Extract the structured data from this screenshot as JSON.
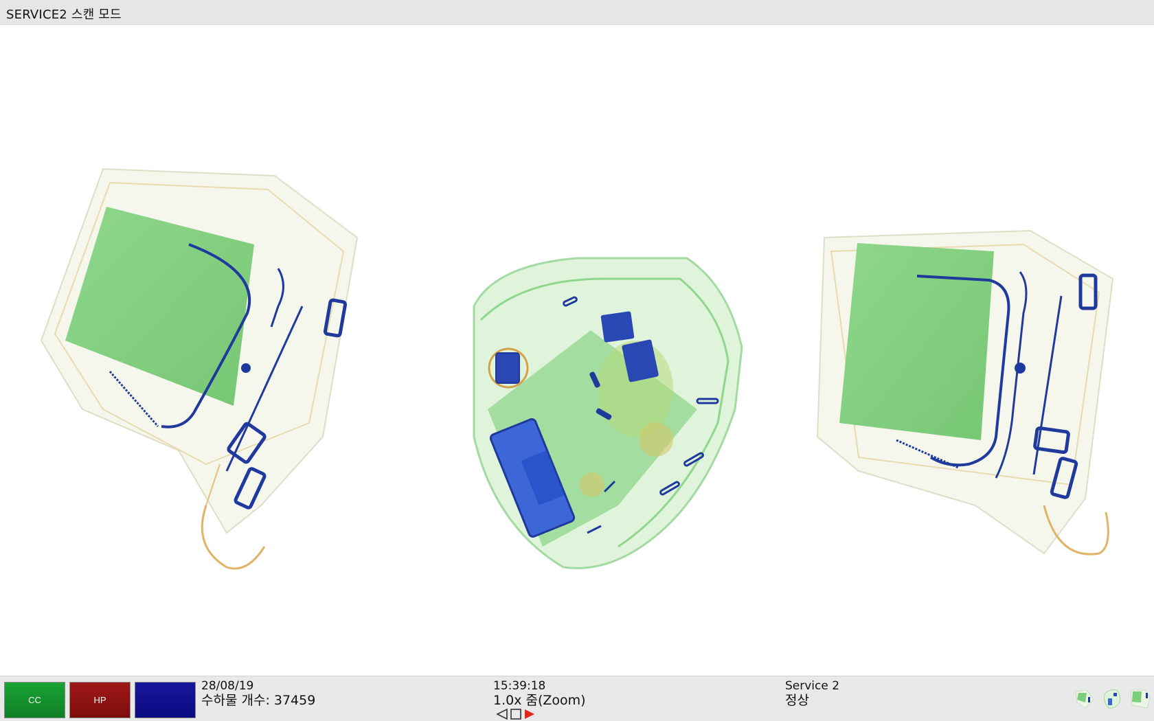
{
  "window": {
    "title": "SERVICE2 스캔 모드"
  },
  "buttons": [
    {
      "id": "cc",
      "label": "CC",
      "color": "#1aa334"
    },
    {
      "id": "hp",
      "label": "HP",
      "color": "#a01818"
    },
    {
      "id": "om",
      "label": "",
      "color": "#16169a"
    }
  ],
  "status": {
    "date": "28/08/19",
    "count_label": "수하물 개수: 37459",
    "time": "15:39:18",
    "zoom": "1.0x 줌(Zoom)",
    "service": "Service 2",
    "state": "정상"
  },
  "icons": {
    "prev": "prev-triangle-icon",
    "stop": "stop-square-icon",
    "play": "play-triangle-icon"
  },
  "colors": {
    "organic": "#7ccf7a",
    "metal": "#1f3a9c",
    "inorganic": "#d9a64a",
    "background": "#ffffff"
  },
  "thumbnails": [
    "left-view",
    "center-view",
    "right-view"
  ]
}
